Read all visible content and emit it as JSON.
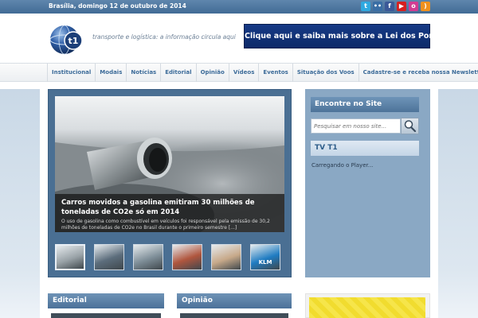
{
  "topbar": {
    "date": "Brasília, domingo 12 de outubro de 2014",
    "social": [
      {
        "icon": "twitter-icon",
        "color": "#2fa9e0",
        "glyph": "t"
      },
      {
        "icon": "flickr-icon",
        "color": "#3a6ea5",
        "glyph": "••"
      },
      {
        "icon": "facebook-icon",
        "color": "#3b5998",
        "glyph": "f"
      },
      {
        "icon": "youtube-icon",
        "color": "#d61f1f",
        "glyph": "▶"
      },
      {
        "icon": "orkut-icon",
        "color": "#d23b92",
        "glyph": "o"
      },
      {
        "icon": "rss-icon",
        "color": "#f0911e",
        "glyph": ")"
      }
    ]
  },
  "header": {
    "logo_text": "t1",
    "tagline": "transporte e logística: a informação circula aqui",
    "banner": "Clique aqui e saiba mais sobre a Lei dos Portos"
  },
  "nav": {
    "items": [
      "Institucional",
      "Modais",
      "Notícias",
      "Editorial",
      "Opinião",
      "Vídeos",
      "Eventos",
      "Situação dos Voos",
      "Cadastre-se e receba nossa Newsletter"
    ]
  },
  "slider": {
    "title": "Carros movidos a gasolina emitiram 30 milhões de toneladas de CO2e só em 2014",
    "description": "O uso de gasolina como combustível em veículos foi responsável pela emissão de 30,2 milhões de toneladas de CO2e no Brasil durante o primeiro semestre [...]",
    "thumbnails": [
      {
        "name": "thumb-exhaust",
        "color": "#9aa3a8"
      },
      {
        "name": "thumb-traffic",
        "color": "#5c6d7c"
      },
      {
        "name": "thumb-highway",
        "color": "#7f8f99"
      },
      {
        "name": "thumb-cyclists",
        "color": "#b0563e"
      },
      {
        "name": "thumb-portrait",
        "color": "#c7a98a"
      },
      {
        "name": "thumb-klm",
        "color": "#1f7cc2",
        "label": "KLM"
      }
    ]
  },
  "sidebar": {
    "search_title": "Encontre no Site",
    "search_placeholder": "Pesquisar em nosso site...",
    "tv_title": "TV T1",
    "player_text": "Carregando o Player..."
  },
  "sections": {
    "editorial": "Editorial",
    "opiniao": "Opinião"
  }
}
